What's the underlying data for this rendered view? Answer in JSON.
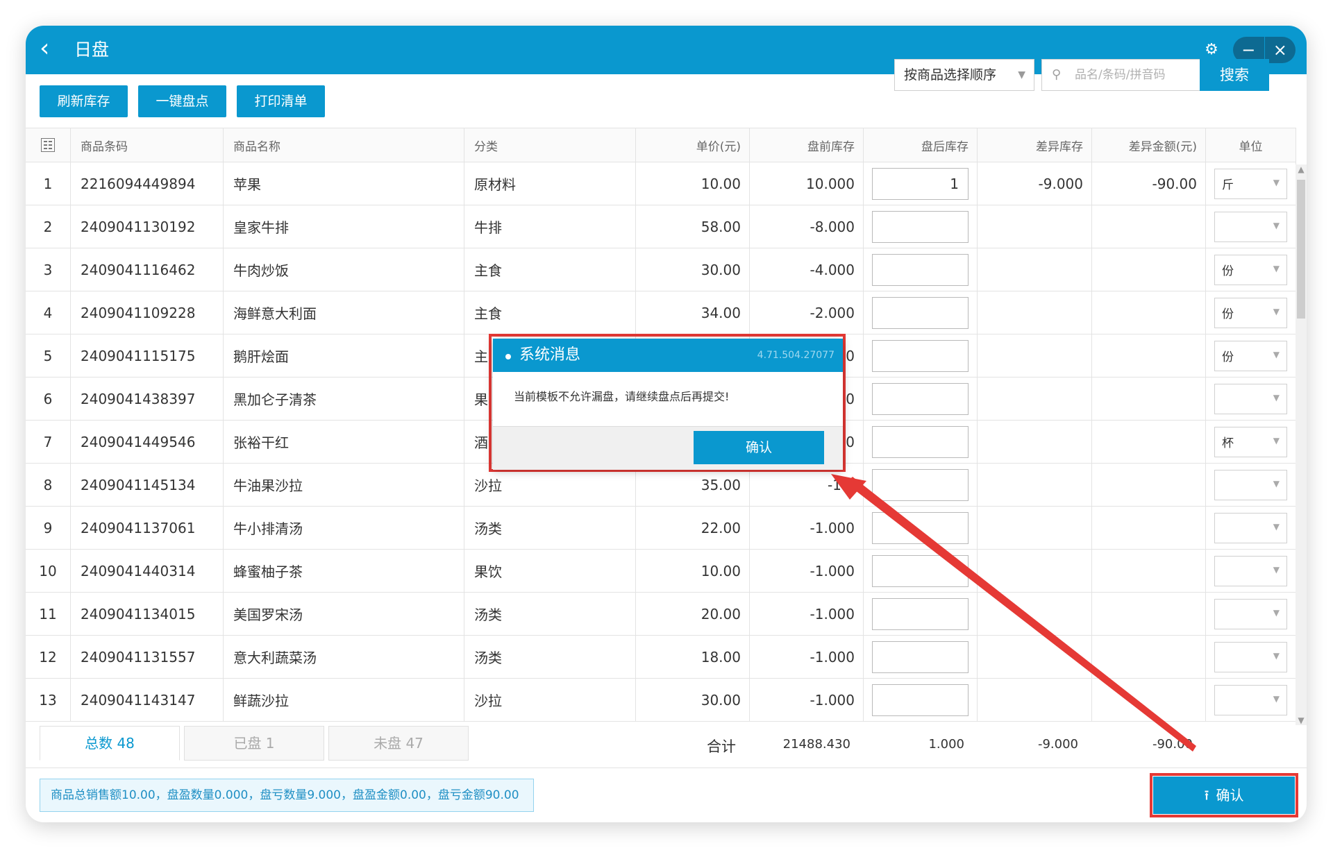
{
  "window": {
    "title": "日盘"
  },
  "toolbar": {
    "refresh_label": "刷新库存",
    "quick_count_label": "一键盘点",
    "print_label": "打印清单",
    "sort_value": "按商品选择顺序",
    "search_placeholder": "品名/条码/拼音码",
    "search_label": "搜索"
  },
  "table": {
    "headers": [
      "商品条码",
      "商品名称",
      "分类",
      "单价(元)",
      "盘前库存",
      "盘后库存",
      "差异库存",
      "差异金额(元)",
      "单位"
    ],
    "rows": [
      {
        "no": "1",
        "code": "2216094449894",
        "name": "苹果",
        "cat": "原材料",
        "price": "10.00",
        "before": "10.000",
        "after": "1",
        "diff": "-9.000",
        "diff_amt": "-90.00",
        "unit": "斤"
      },
      {
        "no": "2",
        "code": "2409041130192",
        "name": "皇家牛排",
        "cat": "牛排",
        "price": "58.00",
        "before": "-8.000",
        "after": "",
        "diff": "",
        "diff_amt": "",
        "unit": ""
      },
      {
        "no": "3",
        "code": "2409041116462",
        "name": "牛肉炒饭",
        "cat": "主食",
        "price": "30.00",
        "before": "-4.000",
        "after": "",
        "diff": "",
        "diff_amt": "",
        "unit": "份"
      },
      {
        "no": "4",
        "code": "2409041109228",
        "name": "海鲜意大利面",
        "cat": "主食",
        "price": "34.00",
        "before": "-2.000",
        "after": "",
        "diff": "",
        "diff_amt": "",
        "unit": "份"
      },
      {
        "no": "5",
        "code": "2409041115175",
        "name": "鹅肝烩面",
        "cat": "主",
        "price": "",
        "before": "0",
        "after": "",
        "diff": "",
        "diff_amt": "",
        "unit": "份"
      },
      {
        "no": "6",
        "code": "2409041438397",
        "name": "黑加仑子清茶",
        "cat": "果",
        "price": "",
        "before": "0",
        "after": "",
        "diff": "",
        "diff_amt": "",
        "unit": ""
      },
      {
        "no": "7",
        "code": "2409041449546",
        "name": "张裕干红",
        "cat": "酒",
        "price": "",
        "before": "0",
        "after": "",
        "diff": "",
        "diff_amt": "",
        "unit": "杯"
      },
      {
        "no": "8",
        "code": "2409041145134",
        "name": "牛油果沙拉",
        "cat": "沙拉",
        "price": "35.00",
        "before": "-1.0",
        "after": "",
        "diff": "",
        "diff_amt": "",
        "unit": ""
      },
      {
        "no": "9",
        "code": "2409041137061",
        "name": "牛小排清汤",
        "cat": "汤类",
        "price": "22.00",
        "before": "-1.000",
        "after": "",
        "diff": "",
        "diff_amt": "",
        "unit": ""
      },
      {
        "no": "10",
        "code": "2409041440314",
        "name": "蜂蜜柚子茶",
        "cat": "果饮",
        "price": "10.00",
        "before": "-1.000",
        "after": "",
        "diff": "",
        "diff_amt": "",
        "unit": ""
      },
      {
        "no": "11",
        "code": "2409041134015",
        "name": "美国罗宋汤",
        "cat": "汤类",
        "price": "20.00",
        "before": "-1.000",
        "after": "",
        "diff": "",
        "diff_amt": "",
        "unit": ""
      },
      {
        "no": "12",
        "code": "2409041131557",
        "name": "意大利蔬菜汤",
        "cat": "汤类",
        "price": "18.00",
        "before": "-1.000",
        "after": "",
        "diff": "",
        "diff_amt": "",
        "unit": ""
      },
      {
        "no": "13",
        "code": "2409041143147",
        "name": "鲜蔬沙拉",
        "cat": "沙拉",
        "price": "30.00",
        "before": "-1.000",
        "after": "",
        "diff": "",
        "diff_amt": "",
        "unit": ""
      }
    ]
  },
  "footer": {
    "tab_total": "总数  48",
    "tab_counted": "已盘  1",
    "tab_uncounted": "未盘  47",
    "total_label": "合计",
    "total_before": "21488.430",
    "total_after": "1.000",
    "total_diff": "-9.000",
    "total_diff_amt": "-90.00"
  },
  "summary": "商品总销售额10.00，盘盈数量0.000，盘亏数量9.000，盘盈金额0.00，盘亏金额90.00",
  "confirm_label": "确认",
  "dialog": {
    "title": "系统消息",
    "version": "4.71.504.27077",
    "message": "当前模板不允许漏盘，请继续盘点后再提交!",
    "button": "确认"
  },
  "colors": {
    "accent": "#0a98cf",
    "highlight": "#e53935"
  }
}
